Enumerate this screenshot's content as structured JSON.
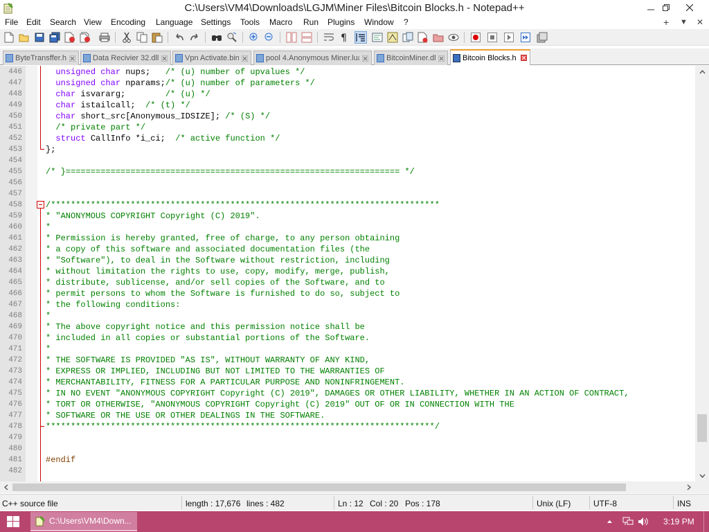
{
  "window": {
    "title": "C:\\Users\\VM4\\Downloads\\LGJM\\Miner Files\\Bitcoin Blocks.h - Notepad++"
  },
  "menu": [
    "File",
    "Edit",
    "Search",
    "View",
    "Encoding",
    "Language",
    "Settings",
    "Tools",
    "Macro",
    "Run",
    "Plugins",
    "Window",
    "?"
  ],
  "menu_right": {
    "plus": "+",
    "dropdown": "▼",
    "close": "✕"
  },
  "toolbar": {
    "icons": [
      "new-file-icon",
      "open-file-icon",
      "save-icon",
      "save-all-icon",
      "close-icon",
      "close-all-icon",
      "print-icon",
      "cut-icon",
      "copy-icon",
      "paste-icon",
      "undo-icon",
      "redo-icon",
      "find-icon",
      "replace-icon",
      "zoom-in-icon",
      "zoom-out-icon",
      "sync-vertical-icon",
      "sync-horizontal-icon",
      "word-wrap-icon",
      "show-all-chars-icon",
      "indent-guide-icon",
      "user-language-icon",
      "document-map-icon",
      "function-list-icon",
      "folder-as-workspace-icon",
      "monitoring-icon",
      "record-macro-icon",
      "stop-recording-icon",
      "playback-macro-icon",
      "run-macro-multiple-icon",
      "save-macro-icon"
    ]
  },
  "tabs": [
    {
      "label": "ByteTransffer.h",
      "active": false
    },
    {
      "label": "Data Recivier 32.dll",
      "active": false
    },
    {
      "label": "Vpn Activate.bin",
      "active": false
    },
    {
      "label": "pool 4.Anonymous Miner.lua",
      "active": false
    },
    {
      "label": "BitcoinMiner.dll",
      "active": false
    },
    {
      "label": "Bitcoin Blocks.h",
      "active": true
    }
  ],
  "code_lines": [
    {
      "n": "446",
      "parts": [
        {
          "t": "  ",
          "c": "id"
        },
        {
          "t": "unsigned char",
          "c": "kw"
        },
        {
          "t": " nups;   ",
          "c": "id"
        },
        {
          "t": "/* (u) number of upvalues */",
          "c": "cm"
        }
      ]
    },
    {
      "n": "447",
      "parts": [
        {
          "t": "  ",
          "c": "id"
        },
        {
          "t": "unsigned char",
          "c": "kw"
        },
        {
          "t": " nparams;",
          "c": "id"
        },
        {
          "t": "/* (u) number of parameters */",
          "c": "cm"
        }
      ]
    },
    {
      "n": "448",
      "parts": [
        {
          "t": "  ",
          "c": "id"
        },
        {
          "t": "char",
          "c": "kw"
        },
        {
          "t": " isvararg;        ",
          "c": "id"
        },
        {
          "t": "/* (u) */",
          "c": "cm"
        }
      ]
    },
    {
      "n": "449",
      "parts": [
        {
          "t": "  ",
          "c": "id"
        },
        {
          "t": "char",
          "c": "kw"
        },
        {
          "t": " istailcall;  ",
          "c": "id"
        },
        {
          "t": "/* (t) */",
          "c": "cm"
        }
      ]
    },
    {
      "n": "450",
      "parts": [
        {
          "t": "  ",
          "c": "id"
        },
        {
          "t": "char",
          "c": "kw"
        },
        {
          "t": " short_src[Anonymous_IDSIZE]; ",
          "c": "id"
        },
        {
          "t": "/* (S) */",
          "c": "cm"
        }
      ]
    },
    {
      "n": "451",
      "parts": [
        {
          "t": "  ",
          "c": "id"
        },
        {
          "t": "/* private part */",
          "c": "cm"
        }
      ]
    },
    {
      "n": "452",
      "parts": [
        {
          "t": "  ",
          "c": "id"
        },
        {
          "t": "struct",
          "c": "kw"
        },
        {
          "t": " CallInfo *i_ci;  ",
          "c": "id"
        },
        {
          "t": "/* active function */",
          "c": "cm"
        }
      ]
    },
    {
      "n": "453",
      "parts": [
        {
          "t": "};",
          "c": "id"
        }
      ]
    },
    {
      "n": "454",
      "parts": []
    },
    {
      "n": "455",
      "parts": [
        {
          "t": "/* }=================================================================== */",
          "c": "cm"
        }
      ]
    },
    {
      "n": "456",
      "parts": []
    },
    {
      "n": "457",
      "parts": []
    },
    {
      "n": "458",
      "parts": [
        {
          "t": "/******************************************************************************",
          "c": "cm"
        }
      ]
    },
    {
      "n": "459",
      "parts": [
        {
          "t": "* \"ANONYMOUS COPYRIGHT Copyright (C) 2019\".",
          "c": "cm"
        }
      ]
    },
    {
      "n": "460",
      "parts": [
        {
          "t": "*",
          "c": "cm"
        }
      ]
    },
    {
      "n": "461",
      "parts": [
        {
          "t": "* Permission is hereby granted, free of charge, to any person obtaining",
          "c": "cm"
        }
      ]
    },
    {
      "n": "462",
      "parts": [
        {
          "t": "* a copy of this software and associated documentation files (the",
          "c": "cm"
        }
      ]
    },
    {
      "n": "463",
      "parts": [
        {
          "t": "* \"Software\"), to deal in the Software without restriction, including",
          "c": "cm"
        }
      ]
    },
    {
      "n": "464",
      "parts": [
        {
          "t": "* without limitation the rights to use, copy, modify, merge, publish,",
          "c": "cm"
        }
      ]
    },
    {
      "n": "465",
      "parts": [
        {
          "t": "* distribute, sublicense, and/or sell copies of the Software, and to",
          "c": "cm"
        }
      ]
    },
    {
      "n": "466",
      "parts": [
        {
          "t": "* permit persons to whom the Software is furnished to do so, subject to",
          "c": "cm"
        }
      ]
    },
    {
      "n": "467",
      "parts": [
        {
          "t": "* the following conditions:",
          "c": "cm"
        }
      ]
    },
    {
      "n": "468",
      "parts": [
        {
          "t": "*",
          "c": "cm"
        }
      ]
    },
    {
      "n": "469",
      "parts": [
        {
          "t": "* The above copyright notice and this permission notice shall be",
          "c": "cm"
        }
      ]
    },
    {
      "n": "470",
      "parts": [
        {
          "t": "* included in all copies or substantial portions of the Software.",
          "c": "cm"
        }
      ]
    },
    {
      "n": "471",
      "parts": [
        {
          "t": "*",
          "c": "cm"
        }
      ]
    },
    {
      "n": "472",
      "parts": [
        {
          "t": "* THE SOFTWARE IS PROVIDED \"AS IS\", WITHOUT WARRANTY OF ANY KIND,",
          "c": "cm"
        }
      ]
    },
    {
      "n": "473",
      "parts": [
        {
          "t": "* EXPRESS OR IMPLIED, INCLUDING BUT NOT LIMITED TO THE WARRANTIES OF",
          "c": "cm"
        }
      ]
    },
    {
      "n": "474",
      "parts": [
        {
          "t": "* MERCHANTABILITY, FITNESS FOR A PARTICULAR PURPOSE AND NONINFRINGEMENT.",
          "c": "cm"
        }
      ]
    },
    {
      "n": "475",
      "parts": [
        {
          "t": "* IN NO EVENT \"ANONYMOUS COPYRIGHT Copyright (C) 2019\", DAMAGES OR OTHER LIABILITY, WHETHER IN AN ACTION OF CONTRACT,",
          "c": "cm"
        }
      ]
    },
    {
      "n": "476",
      "parts": [
        {
          "t": "* TORT OR OTHERWISE, \"ANONYMOUS COPYRIGHT Copyright (C) 2019\" OUT OF OR IN CONNECTION WITH THE",
          "c": "cm"
        }
      ]
    },
    {
      "n": "477",
      "parts": [
        {
          "t": "* SOFTWARE OR THE USE OR OTHER DEALINGS IN THE SOFTWARE.",
          "c": "cm"
        }
      ]
    },
    {
      "n": "478",
      "parts": [
        {
          "t": "******************************************************************************/",
          "c": "cm"
        }
      ]
    },
    {
      "n": "479",
      "parts": []
    },
    {
      "n": "480",
      "parts": []
    },
    {
      "n": "481",
      "parts": [
        {
          "t": "#endif",
          "c": "pp"
        }
      ]
    },
    {
      "n": "482",
      "parts": []
    }
  ],
  "status": {
    "lang": "C++ source file",
    "length": "length : 17,676",
    "lines": "lines : 482",
    "ln": "Ln : 12",
    "col": "Col : 20",
    "pos": "Pos : 178",
    "eol": "Unix (LF)",
    "encoding": "UTF-8",
    "mode": "INS"
  },
  "taskbar": {
    "task_label": "C:\\Users\\VM4\\Down...",
    "clock": "3:19 PM"
  },
  "colors": {
    "keyword": "#8000ff",
    "comment": "#008000",
    "preprocessor": "#804000",
    "fold_marker": "#d00000",
    "active_tab_accent": "#f0a030",
    "taskbar": "#b8456d"
  }
}
